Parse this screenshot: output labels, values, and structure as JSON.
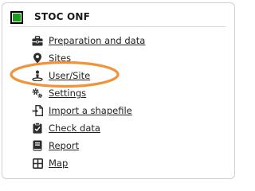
{
  "panel": {
    "title": "STOC ONF",
    "brand_color": "#1a9c1a"
  },
  "highlight": {
    "color": "#f0933b",
    "target": "User/Site"
  },
  "menu": {
    "items": [
      {
        "label": "Preparation and data",
        "icon": "toolbox-icon"
      },
      {
        "label": "Sites",
        "icon": "map-pin-icon"
      },
      {
        "label": "User/Site",
        "icon": "user-location-icon"
      },
      {
        "label": "Settings",
        "icon": "gears-icon"
      },
      {
        "label": "Import a shapefile",
        "icon": "import-file-icon"
      },
      {
        "label": "Check data",
        "icon": "clipboard-check-icon"
      },
      {
        "label": "Report",
        "icon": "book-icon"
      },
      {
        "label": "Map",
        "icon": "grid-map-icon"
      }
    ]
  }
}
